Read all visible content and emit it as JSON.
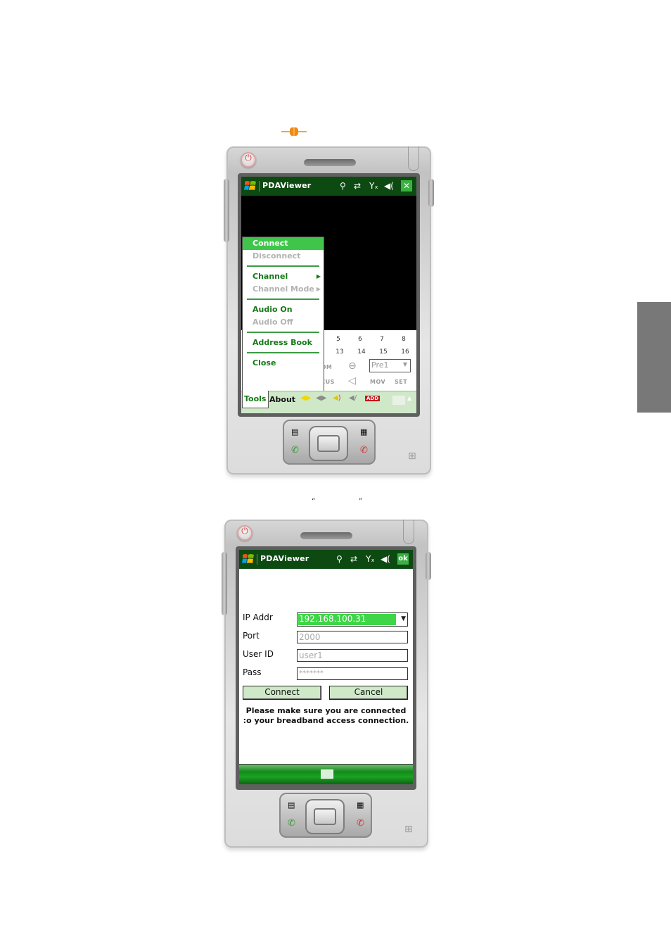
{
  "page": {
    "connector_icon": "plug-connector-icon",
    "caption_quotes": {
      "open": "“",
      "close": "”"
    },
    "side_tab_color": "#787878"
  },
  "device1": {
    "titlebar": {
      "app_title": "PDAViewer",
      "icons": [
        "windows-start-icon",
        "signal-antenna-icon",
        "sync-arrows-icon",
        "no-signal-icon",
        "volume-icon",
        "close-icon"
      ],
      "close_label": "✕",
      "bg_color": "#0d4a12"
    },
    "menu": {
      "items": [
        {
          "label": "Connect",
          "state": "selected"
        },
        {
          "label": "Disconnect",
          "state": "disabled"
        },
        {
          "label": "Channel",
          "state": "enabled",
          "submenu": true
        },
        {
          "label": "Channel Mode",
          "state": "disabled",
          "submenu": true
        },
        {
          "label": "Audio On",
          "state": "enabled"
        },
        {
          "label": "Audio Off",
          "state": "disabled"
        },
        {
          "label": "Address Book",
          "state": "enabled"
        },
        {
          "label": "Close",
          "state": "enabled"
        }
      ],
      "submenu_arrow": "▶",
      "selected_color": "#3fc64a",
      "text_color": "#137a16"
    },
    "channels": {
      "row1": [
        "5",
        "6",
        "7",
        "8"
      ],
      "row2": [
        "13",
        "14",
        "15",
        "16"
      ]
    },
    "ptz": {
      "zoom_label": "ZOOM",
      "focus_label": "FOCUS",
      "mov_label": "MOV",
      "set_label": "SET",
      "preset_value": "Pre1",
      "zoom_out_icon": "zoom-out-icon",
      "focus_icon": "focus-icon"
    },
    "toolbar": {
      "tools_label": "Tools",
      "about_label": "About",
      "icons": [
        "talk-on-icon",
        "talk-off-icon",
        "speaker-on-icon",
        "speaker-mute-icon",
        "add-icon",
        "keyboard-icon",
        "up-arrow-icon"
      ],
      "add_label": "ADD",
      "bg_color": "#cfe9c8"
    }
  },
  "device2": {
    "titlebar": {
      "app_title": "PDAViewer",
      "ok_label": "ok",
      "icons": [
        "windows-start-icon",
        "signal-antenna-icon",
        "sync-arrows-icon",
        "no-signal-icon",
        "volume-icon",
        "ok-icon"
      ]
    },
    "form": {
      "ip_label": "IP Addr",
      "ip_value": "192.168.100.31",
      "port_label": "Port",
      "port_value": "2000",
      "user_label": "User ID",
      "user_value": "user1",
      "pass_label": "Pass",
      "pass_value": "*******",
      "connect_label": "Connect",
      "cancel_label": "Cancel",
      "note_line1": "Please make sure you are connected",
      "note_line2": ":o your breadband access connection."
    },
    "softbar": {
      "icon": "keyboard-icon"
    }
  }
}
